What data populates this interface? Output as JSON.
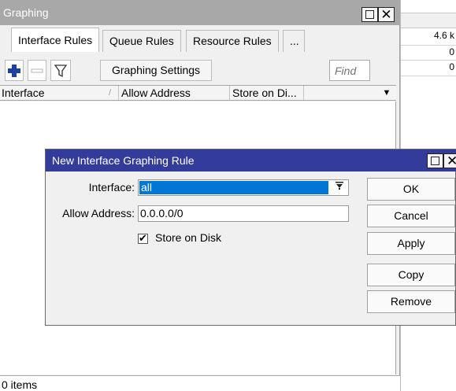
{
  "background_panel": {
    "values": [
      "4.6 k",
      "0",
      "0"
    ]
  },
  "graphing": {
    "title": "Graphing",
    "tabs": [
      {
        "label": "Interface Rules",
        "active": true
      },
      {
        "label": "Queue Rules",
        "active": false
      },
      {
        "label": "Resource Rules",
        "active": false
      },
      {
        "label": "...",
        "active": false
      }
    ],
    "toolbar": {
      "add_icon": "plus-icon",
      "remove_icon": "minus-icon",
      "filter_icon": "filter-icon",
      "settings_label": "Graphing Settings",
      "find_placeholder": "Find"
    },
    "columns": [
      "Interface",
      "Allow Address",
      "Store on Di..."
    ],
    "sort_marker": "/",
    "status": "0 items"
  },
  "dialog": {
    "title": "New Interface Graphing Rule",
    "fields": {
      "interface_label": "Interface:",
      "interface_value": "all",
      "allow_address_label": "Allow Address:",
      "allow_address_value": "0.0.0.0/0",
      "store_on_disk_label": "Store on Disk",
      "store_on_disk_checked": true
    },
    "buttons": [
      "OK",
      "Cancel",
      "Apply",
      "Copy",
      "Remove"
    ]
  },
  "colors": {
    "dialog_titlebar": "#343c9b",
    "inactive_titlebar": "#a8a8a8",
    "selection": "#0076d7",
    "add_icon": "#1f3fa6"
  }
}
